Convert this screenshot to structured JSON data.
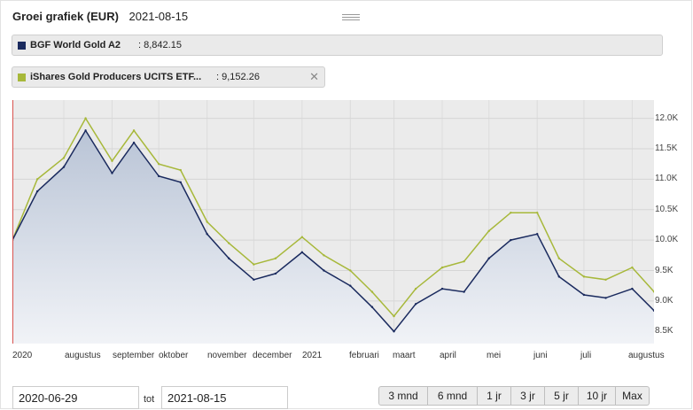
{
  "header": {
    "title": "Groei grafiek (EUR)",
    "date": "2021-08-15"
  },
  "legend": [
    {
      "name": "BGF World Gold A2",
      "value": "8,842.15",
      "color": "#1a2a5e",
      "closable": false
    },
    {
      "name": "iShares Gold Producers UCITS ETF...",
      "value": "9,152.26",
      "color": "#a7b83a",
      "closable": true
    }
  ],
  "chart_data": {
    "type": "line",
    "x": [
      "2020-06-29",
      "2020-07-15",
      "2020-08-01",
      "2020-08-15",
      "2020-09-01",
      "2020-09-15",
      "2020-10-01",
      "2020-10-15",
      "2020-11-01",
      "2020-11-15",
      "2020-12-01",
      "2020-12-15",
      "2021-01-01",
      "2021-01-15",
      "2021-02-01",
      "2021-02-15",
      "2021-03-01",
      "2021-03-15",
      "2021-04-01",
      "2021-04-15",
      "2021-05-01",
      "2021-05-15",
      "2021-06-01",
      "2021-06-15",
      "2021-07-01",
      "2021-07-15",
      "2021-08-01",
      "2021-08-15"
    ],
    "series": [
      {
        "name": "BGF World Gold A2",
        "values": [
          10000,
          10800,
          11200,
          11800,
          11100,
          11600,
          11050,
          10950,
          10100,
          9700,
          9350,
          9450,
          9800,
          9500,
          9250,
          8900,
          8500,
          8950,
          9200,
          9150,
          9700,
          10000,
          10100,
          9400,
          9100,
          9050,
          9200,
          8842
        ]
      },
      {
        "name": "iShares Gold Producers UCITS ETF...",
        "values": [
          10000,
          11000,
          11350,
          12000,
          11300,
          11800,
          11250,
          11150,
          10300,
          9950,
          9600,
          9700,
          10050,
          9750,
          9500,
          9150,
          8750,
          9200,
          9550,
          9650,
          10150,
          10450,
          10450,
          9700,
          9400,
          9350,
          9550,
          9152
        ]
      }
    ],
    "xlabels": [
      "2020",
      "augustus",
      "september",
      "oktober",
      "november",
      "december",
      "2021",
      "februari",
      "maart",
      "april",
      "mei",
      "juni",
      "juli",
      "augustus"
    ],
    "ytick_labels": [
      "12.0K",
      "11.5K",
      "11.0K",
      "10.5K",
      "10.0K",
      "9.5K",
      "9.0K",
      "8.5K"
    ],
    "yticks": [
      12000,
      11500,
      11000,
      10500,
      10000,
      9500,
      9000,
      8500
    ],
    "ylim": [
      8300,
      12300
    ],
    "grid": true
  },
  "range": {
    "from": "2020-06-29",
    "to_label": "tot",
    "to": "2021-08-15"
  },
  "buttons": [
    "3 mnd",
    "6 mnd",
    "1 jr",
    "3 jr",
    "5 jr",
    "10 jr",
    "Max"
  ]
}
